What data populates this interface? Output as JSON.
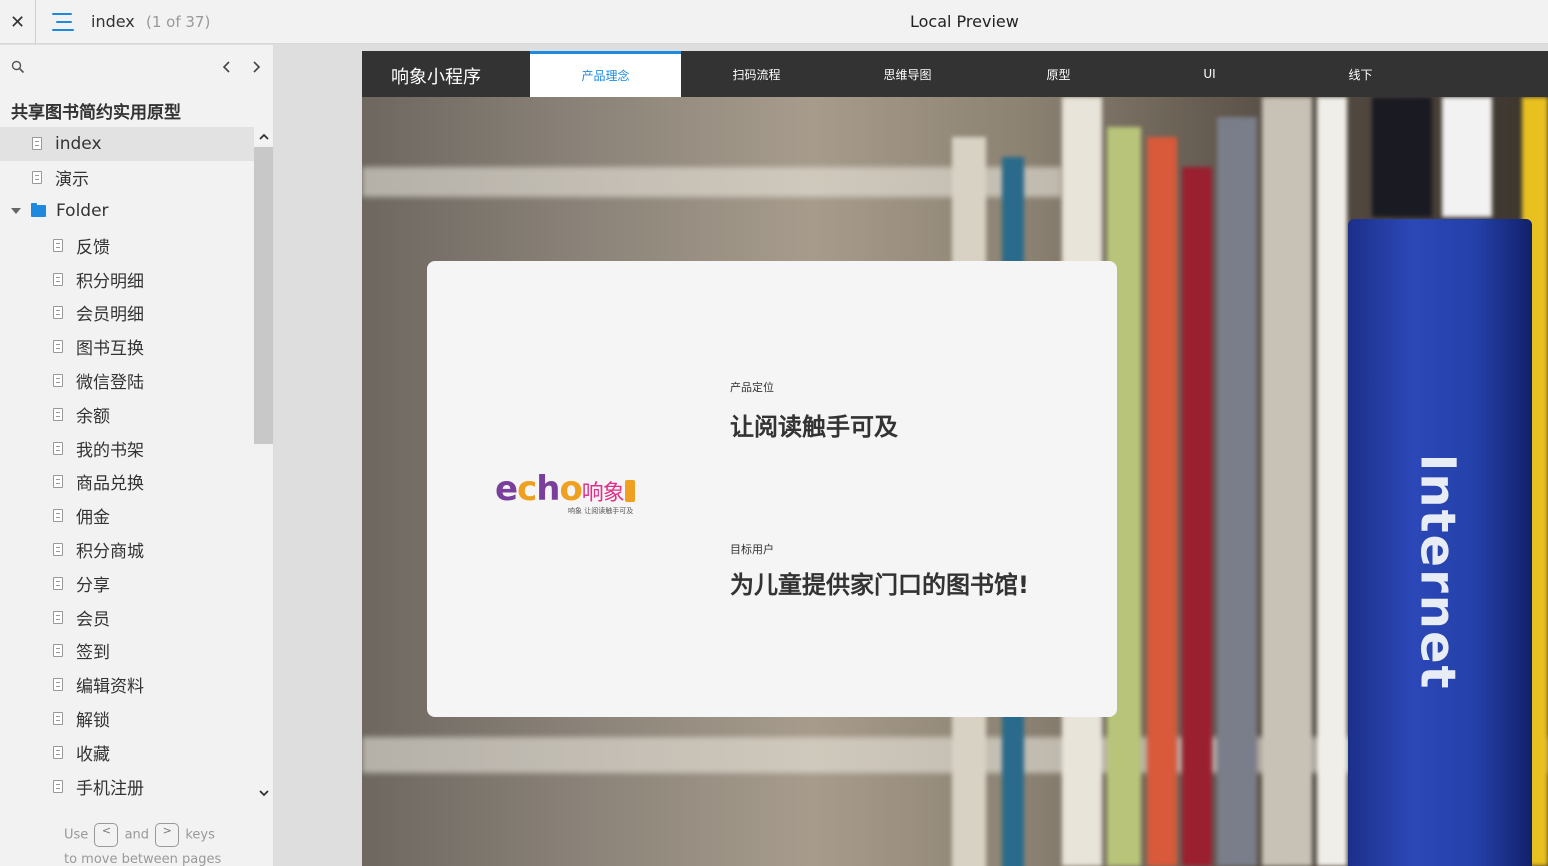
{
  "topbar": {
    "close_glyph": "✕",
    "current_page": "index",
    "page_count": "(1 of 37)",
    "preview_title": "Local Preview"
  },
  "sidebar": {
    "project_title": "共享图书简约实用原型",
    "items": [
      {
        "label": "index",
        "type": "page",
        "level": 0,
        "selected": true
      },
      {
        "label": "演示",
        "type": "page",
        "level": 0
      },
      {
        "label": "Folder",
        "type": "folder",
        "level": 0
      },
      {
        "label": "反馈",
        "type": "page",
        "level": 1
      },
      {
        "label": "积分明细",
        "type": "page",
        "level": 1
      },
      {
        "label": "会员明细",
        "type": "page",
        "level": 1
      },
      {
        "label": "图书互换",
        "type": "page",
        "level": 1
      },
      {
        "label": "微信登陆",
        "type": "page",
        "level": 1
      },
      {
        "label": "余额",
        "type": "page",
        "level": 1
      },
      {
        "label": "我的书架",
        "type": "page",
        "level": 1
      },
      {
        "label": "商品兑换",
        "type": "page",
        "level": 1
      },
      {
        "label": "佣金",
        "type": "page",
        "level": 1
      },
      {
        "label": "积分商城",
        "type": "page",
        "level": 1
      },
      {
        "label": "分享",
        "type": "page",
        "level": 1
      },
      {
        "label": "会员",
        "type": "page",
        "level": 1
      },
      {
        "label": "签到",
        "type": "page",
        "level": 1
      },
      {
        "label": "编辑资料",
        "type": "page",
        "level": 1
      },
      {
        "label": "解锁",
        "type": "page",
        "level": 1
      },
      {
        "label": "收藏",
        "type": "page",
        "level": 1
      },
      {
        "label": "手机注册",
        "type": "page",
        "level": 1
      }
    ],
    "help": {
      "use": "Use",
      "key_prev": "<",
      "and": "and",
      "key_next": ">",
      "keys": "keys",
      "line2": "to move between pages"
    }
  },
  "prototype": {
    "brand": "响象小程序",
    "tabs": [
      {
        "label": "产品理念",
        "active": true
      },
      {
        "label": "扫码流程"
      },
      {
        "label": "思维导图"
      },
      {
        "label": "原型"
      },
      {
        "label": "UI"
      },
      {
        "label": "线下"
      }
    ],
    "card": {
      "logo_text": "echo响象",
      "logo_tagline": "响象  让阅读触手可及",
      "section1_label": "产品定位",
      "section1_text": "让阅读触手可及",
      "section2_label": "目标用户",
      "section2_text": "为儿童提供家门口的图书馆!"
    },
    "book_spine_text": "Internet"
  },
  "colors": {
    "accent": "#1d8ae0",
    "nav_bg": "#333333",
    "sidebar_bg": "#f2f2f2",
    "logo_purple": "#7a3f9a",
    "logo_orange": "#f0a020",
    "logo_pink": "#e0308a"
  }
}
